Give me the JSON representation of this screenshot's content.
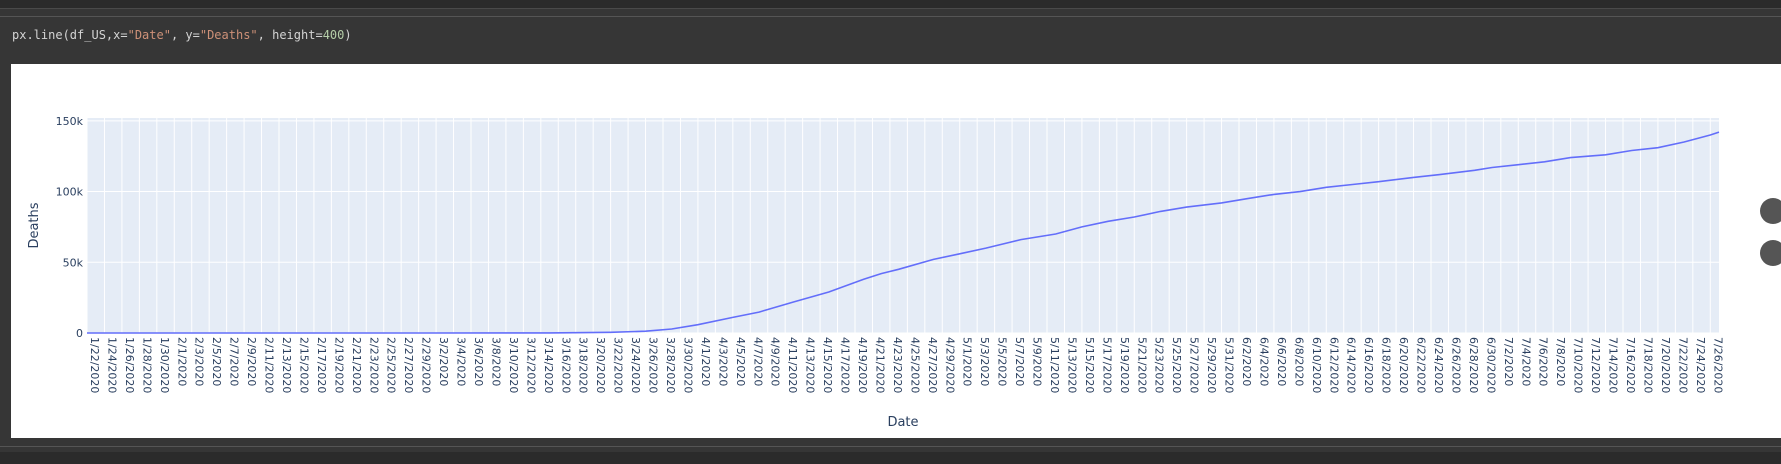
{
  "cell": {
    "code_prefix": "px.line(df_US,x=",
    "code_str1": "\"Date\"",
    "code_mid": ", y=",
    "code_str2": "\"Deaths\"",
    "code_mid2": ", height=",
    "code_num": "400",
    "code_suffix": ")"
  },
  "colors": {
    "line": "#636efa",
    "plot_bg": "#e5ecf6",
    "grid": "#ffffff",
    "axis_text": "#2a3f5f"
  },
  "chart_data": {
    "type": "line",
    "xlabel": "Date",
    "ylabel": "Deaths",
    "ylim": [
      0,
      150000
    ],
    "yticks": [
      0,
      50000,
      100000,
      150000
    ],
    "ytick_labels": [
      "0",
      "50k",
      "100k",
      "150k"
    ],
    "grid": true,
    "x_start": "1/22/2020",
    "x_end": "7/27/2020",
    "series": [
      {
        "points": [
          [
            "1/22/2020",
            0
          ],
          [
            "3/1/2020",
            1
          ],
          [
            "3/15/2020",
            63
          ],
          [
            "3/22/2020",
            471
          ],
          [
            "3/26/2020",
            1300
          ],
          [
            "3/29/2020",
            2860
          ],
          [
            "4/1/2020",
            5900
          ],
          [
            "4/5/2020",
            11000
          ],
          [
            "4/8/2020",
            14800
          ],
          [
            "4/12/2020",
            22000
          ],
          [
            "4/16/2020",
            29000
          ],
          [
            "4/20/2020",
            38000
          ],
          [
            "4/22/2020",
            42000
          ],
          [
            "4/24/2020",
            45000
          ],
          [
            "4/28/2020",
            52000
          ],
          [
            "5/1/2020",
            56000
          ],
          [
            "5/4/2020",
            60000
          ],
          [
            "5/8/2020",
            66000
          ],
          [
            "5/12/2020",
            70000
          ],
          [
            "5/15/2020",
            75000
          ],
          [
            "5/18/2020",
            79000
          ],
          [
            "5/21/2020",
            82000
          ],
          [
            "5/24/2020",
            86000
          ],
          [
            "5/27/2020",
            89000
          ],
          [
            "5/31/2020",
            92000
          ],
          [
            "6/3/2020",
            95000
          ],
          [
            "6/6/2020",
            98000
          ],
          [
            "6/9/2020",
            100000
          ],
          [
            "6/12/2020",
            103000
          ],
          [
            "6/15/2020",
            105000
          ],
          [
            "6/18/2020",
            107000
          ],
          [
            "6/22/2020",
            110000
          ],
          [
            "6/25/2020",
            112000
          ],
          [
            "6/29/2020",
            115000
          ],
          [
            "7/1/2020",
            117000
          ],
          [
            "7/4/2020",
            119000
          ],
          [
            "7/7/2020",
            121000
          ],
          [
            "7/10/2020",
            124000
          ],
          [
            "7/12/2020",
            125000
          ],
          [
            "7/14/2020",
            126000
          ],
          [
            "7/17/2020",
            129000
          ],
          [
            "7/20/2020",
            131000
          ],
          [
            "7/23/2020",
            135000
          ],
          [
            "7/26/2020",
            140000
          ],
          [
            "7/27/2020",
            142000
          ]
        ]
      }
    ]
  }
}
